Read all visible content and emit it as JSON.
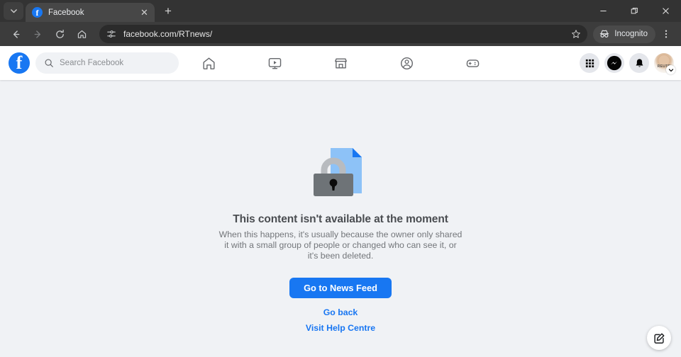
{
  "browser": {
    "tab_list_icon": "chevron-down-icon",
    "tab": {
      "title": "Facebook",
      "favicon_letter": "f",
      "close_label": "✕"
    },
    "new_tab_label": "+",
    "window_controls": {
      "minimize": "—",
      "maximize": "❐",
      "close": "✕"
    },
    "nav": {
      "back": "←",
      "forward": "→",
      "reload": "⟳",
      "home": "home-icon"
    },
    "omnibox": {
      "url": "facebook.com/RTnews/",
      "site_settings_icon": "tune-icon",
      "bookmark_icon": "star-icon"
    },
    "incognito": {
      "label": "Incognito",
      "icon": "incognito-hat-icon"
    },
    "menu_icon": "kebab-menu-icon"
  },
  "fb": {
    "logo_letter": "f",
    "search": {
      "placeholder": "Search Facebook",
      "icon": "search-icon"
    },
    "nav_items": [
      {
        "name": "home",
        "label": "Home"
      },
      {
        "name": "watch",
        "label": "Video"
      },
      {
        "name": "marketplace",
        "label": "Marketplace"
      },
      {
        "name": "groups",
        "label": "Groups"
      },
      {
        "name": "gaming",
        "label": "Gaming"
      }
    ],
    "right_items": [
      {
        "name": "menu-grid",
        "label": "Menu"
      },
      {
        "name": "messenger",
        "label": "Messenger"
      },
      {
        "name": "notifications",
        "label": "Notifications"
      }
    ],
    "avatar": {
      "name": "account-avatar",
      "caption": "REUTE"
    },
    "fab": {
      "name": "compose-icon",
      "label": "New message"
    }
  },
  "error": {
    "illustration": "locked-document-icon",
    "title": "This content isn't available at the moment",
    "body": "When this happens, it's usually because the owner only shared it with a small group of people or changed who can see it, or it's been deleted.",
    "primary_button": "Go to News Feed",
    "link_back": "Go back",
    "link_help": "Visit Help Centre"
  },
  "colors": {
    "fb_blue": "#1877f2",
    "link_blue": "#1876f2",
    "page_bg": "#f0f2f5",
    "chrome_tabstrip": "#333333",
    "chrome_toolbar": "#3c3c3c"
  }
}
